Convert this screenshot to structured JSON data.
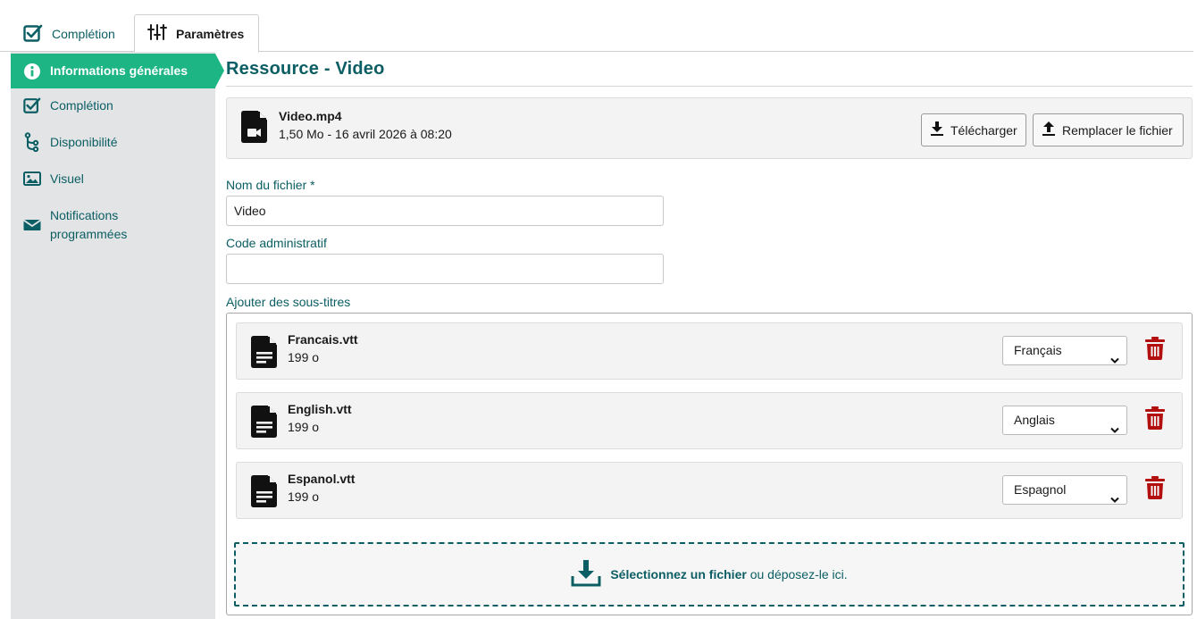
{
  "tabs": [
    {
      "label": "Complétion",
      "icon": "checkbox-icon"
    },
    {
      "label": "Paramètres",
      "icon": "sliders-icon"
    }
  ],
  "sidebar": {
    "items": [
      {
        "label": "Informations générales",
        "icon": "info-icon",
        "active": true
      },
      {
        "label": "Complétion",
        "icon": "checkbox-icon"
      },
      {
        "label": "Disponibilité",
        "icon": "branch-icon"
      },
      {
        "label": "Visuel",
        "icon": "image-icon"
      },
      {
        "label_line1": "Notifications",
        "label_line2": "programmées",
        "icon": "envelope-icon"
      }
    ]
  },
  "main": {
    "title": "Ressource - Video",
    "file": {
      "name": "Video.mp4",
      "meta": "1,50 Mo - 16 avril 2026 à 08:20",
      "download_label": "Télécharger",
      "replace_label": "Remplacer le fichier"
    },
    "form": {
      "filename_label": "Nom du fichier *",
      "filename_value": "Video",
      "admin_code_label": "Code administratif",
      "admin_code_value": "",
      "subtitles_label": "Ajouter des sous-titres"
    },
    "subtitles": [
      {
        "name": "Francais.vtt",
        "size": "199 o",
        "language": "Français"
      },
      {
        "name": "English.vtt",
        "size": "199 o",
        "language": "Anglais"
      },
      {
        "name": "Espanol.vtt",
        "size": "199 o",
        "language": "Espagnol"
      }
    ],
    "dropzone": {
      "select_label": "Sélectionnez un fichier",
      "rest_label": " ou déposez-le ici."
    }
  },
  "colors": {
    "accent": "#1eb584",
    "teal": "#0b5e63",
    "delete": "#b30f0f",
    "sidebar_bg": "#e2e4e6"
  }
}
